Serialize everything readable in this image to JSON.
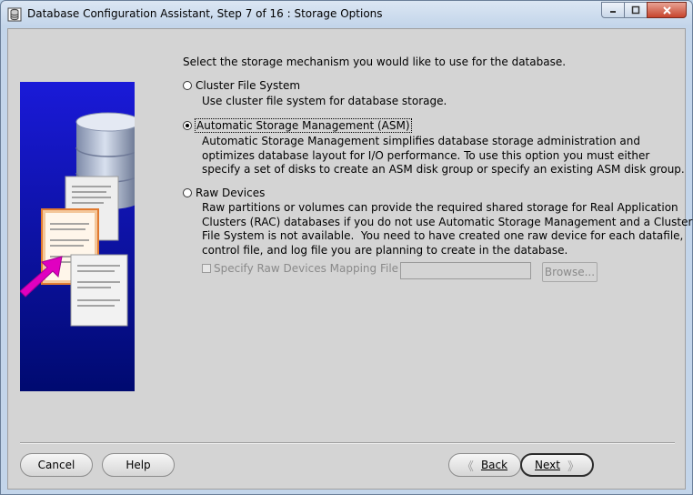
{
  "window": {
    "title": "Database Configuration Assistant, Step 7 of 16 : Storage Options",
    "icon": "database-icon",
    "controls": [
      "minimize-icon",
      "maximize-icon",
      "close-icon"
    ]
  },
  "content": {
    "intro": "Select the storage mechanism you would like to use for the database.",
    "options": [
      {
        "label": "Cluster File System",
        "selected": false,
        "description": "Use cluster file system for database storage."
      },
      {
        "label": "Automatic Storage Management (ASM)",
        "selected": true,
        "description": "Automatic Storage Management simplifies database storage administration and\noptimizes database layout for I/O performance. To use this option you must either\nspecify a set of disks to create an ASM disk group or specify an existing ASM disk group."
      },
      {
        "label": "Raw Devices",
        "selected": false,
        "description": "Raw partitions or volumes can provide the required shared storage for Real Application\nClusters (RAC) databases if you do not use Automatic Storage Management and a Cluster\nFile System is not available.  You need to have created one raw device for each datafile,\ncontrol file, and log file you are planning to create in the database."
      }
    ],
    "mapping": {
      "checkbox_label": "Specify Raw Devices Mapping File",
      "checked": false,
      "enabled": false,
      "file_value": "",
      "browse_label": "Browse..."
    }
  },
  "footer": {
    "cancel": "Cancel",
    "help": "Help",
    "back": "Back",
    "next": "Next",
    "back_arrow": "《",
    "next_arrow": "》"
  },
  "colors": {
    "image_background": "#1010c8",
    "panel_background": "#d4d4d4",
    "arrow_accent": "#e000c0"
  }
}
